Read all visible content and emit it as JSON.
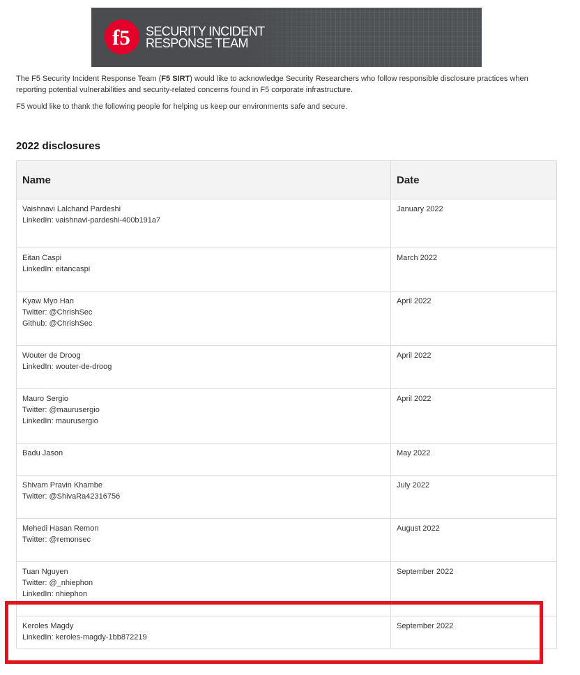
{
  "banner": {
    "logo_text": "f5",
    "line1": "SECURITY INCIDENT",
    "line2": "RESPONSE TEAM",
    "colors": {
      "logo_red": "#e4002b",
      "banner_bg": "#505356"
    }
  },
  "intro": {
    "p1_before": "The F5 Security Incident Response Team (",
    "p1_bold": "F5 SIRT",
    "p1_after": ") would like to acknowledge Security Researchers who follow responsible disclosure practices when reporting potential vulnerabilities and security-related concerns found in F5 corporate infrastructure.",
    "p2": "F5 would like to thank the following people for helping us keep our environments safe and secure."
  },
  "section_title": "2022 disclosures",
  "table": {
    "headers": [
      "Name",
      "Date"
    ],
    "rows": [
      {
        "lines": [
          "Vaishnavi Lalchand Pardeshi",
          "LinkedIn: vaishnavi-pardeshi-400b191a7"
        ],
        "date": "January 2022"
      },
      {
        "lines": [
          "Eitan Caspi",
          "LinkedIn: eitancaspi"
        ],
        "date": "March 2022"
      },
      {
        "lines": [
          "Kyaw Myo Han",
          "Twitter: @ChrishSec",
          "Github: @ChrishSec"
        ],
        "date": "April 2022"
      },
      {
        "lines": [
          "Wouter de Droog",
          "LinkedIn: wouter-de-droog"
        ],
        "date": "April 2022"
      },
      {
        "lines": [
          "Mauro Sergio",
          "Twitter: @maurusergio",
          "LinkedIn: maurusergio"
        ],
        "date": "April 2022"
      },
      {
        "lines": [
          "Badu Jason"
        ],
        "date": "May 2022"
      },
      {
        "lines": [
          "Shivam Pravin Khambe",
          "Twitter: @ShivaRa42316756"
        ],
        "date": "July 2022"
      },
      {
        "lines": [
          "Mehedi Hasan Remon",
          "Twitter: @remonsec"
        ],
        "date": "August 2022"
      },
      {
        "lines": [
          "Tuan Nguyen",
          "Twitter: @_nhiephon",
          "LinkedIn: nhiephon"
        ],
        "date": "September 2022"
      },
      {
        "lines": [
          "Keroles Magdy",
          "LinkedIn: keroles-magdy-1bb872219"
        ],
        "date": "September 2022"
      }
    ]
  },
  "highlight_color": "#e0141b"
}
